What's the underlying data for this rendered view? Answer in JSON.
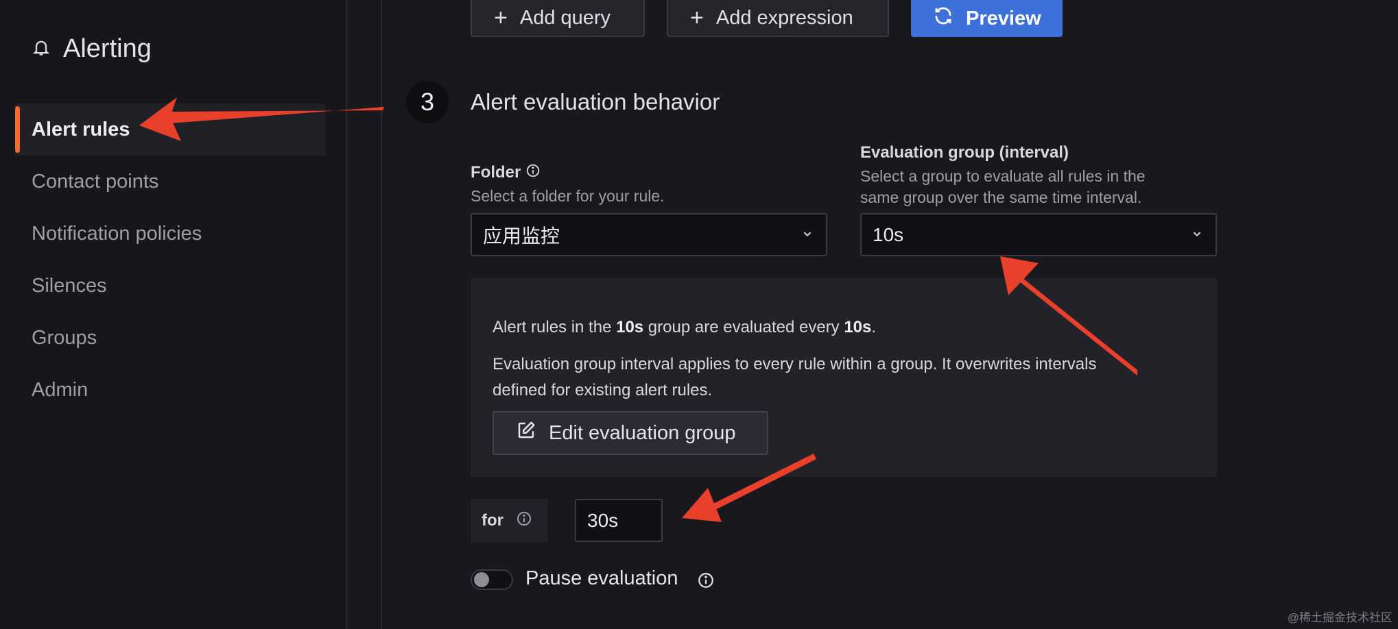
{
  "sidebar": {
    "title": "Alerting",
    "items": [
      {
        "label": "Alert rules",
        "active": true
      },
      {
        "label": "Contact points"
      },
      {
        "label": "Notification policies"
      },
      {
        "label": "Silences"
      },
      {
        "label": "Groups"
      },
      {
        "label": "Admin"
      }
    ]
  },
  "toolbar": {
    "add_query": "Add query",
    "add_expression": "Add expression",
    "preview": "Preview"
  },
  "section": {
    "step": "3",
    "title": "Alert evaluation behavior"
  },
  "folder": {
    "label": "Folder",
    "description": "Select a folder for your rule.",
    "value": "应用监控"
  },
  "evaluation_group": {
    "label": "Evaluation group (interval)",
    "description_line1": "Select a group to evaluate all rules in the",
    "description_line2": "same group over the same time interval.",
    "value": "10s"
  },
  "info": {
    "line1_prefix": "Alert rules in the ",
    "line1_group": "10s",
    "line1_middle": " group are evaluated every ",
    "line1_interval": "10s",
    "line1_suffix": ".",
    "line2": "Evaluation group interval applies to every rule within a group. It overwrites intervals",
    "line3": "defined for existing alert rules.",
    "edit_button": "Edit evaluation group"
  },
  "pending": {
    "label": "for",
    "value": "30s"
  },
  "pause": {
    "label": "Pause evaluation",
    "enabled": false
  },
  "watermark": "@稀土掘金技术社区",
  "colors": {
    "accent": "#f56a31",
    "primary": "#3d71d9",
    "annotation_arrow": "#e8402a"
  }
}
